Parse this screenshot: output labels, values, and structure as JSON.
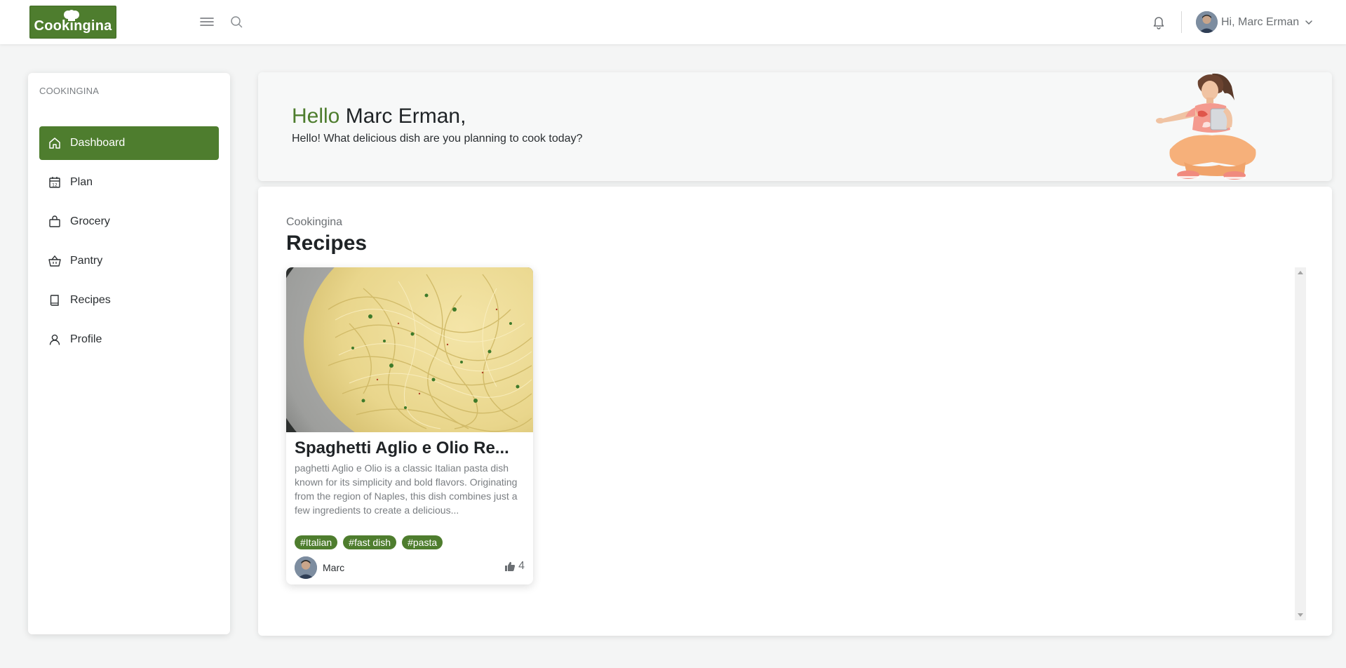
{
  "app": {
    "logo_text": "Cookingina",
    "user_greeting": "Hi, Marc Erman"
  },
  "icons": {
    "menu": "menu-icon",
    "search": "search-icon",
    "notifications": "bell-icon",
    "dropdown": "chevron-down-icon"
  },
  "colors": {
    "brand": "#4e7d2e",
    "background": "#f4f5f5"
  },
  "sidebar": {
    "caption": "COOKINGINA",
    "items": [
      {
        "label": "Dashboard",
        "icon": "home-icon",
        "active": true
      },
      {
        "label": "Plan",
        "icon": "calendar-icon",
        "active": false
      },
      {
        "label": "Grocery",
        "icon": "shopping-bag-icon",
        "active": false
      },
      {
        "label": "Pantry",
        "icon": "basket-icon",
        "active": false
      },
      {
        "label": "Recipes",
        "icon": "book-icon",
        "active": false
      },
      {
        "label": "Profile",
        "icon": "user-icon",
        "active": false
      }
    ]
  },
  "hero": {
    "greeting_accent": "Hello",
    "greeting_name": " Marc Erman,",
    "subtitle": "Hello! What delicious dish are you planning to cook today?"
  },
  "main": {
    "breadcrumb": "Cookingina",
    "title": "Recipes",
    "recipes": [
      {
        "title": "Spaghetti Aglio e Olio Re...",
        "description": "paghetti Aglio e Olio is a classic Italian pasta dish known for its simplicity and bold flavors. Originating from the region of Naples, this dish combines just a few ingredients to create a delicious...",
        "tags": [
          "#Italian",
          "#fast dish",
          "#pasta"
        ],
        "author": "Marc",
        "likes": "4"
      }
    ]
  }
}
